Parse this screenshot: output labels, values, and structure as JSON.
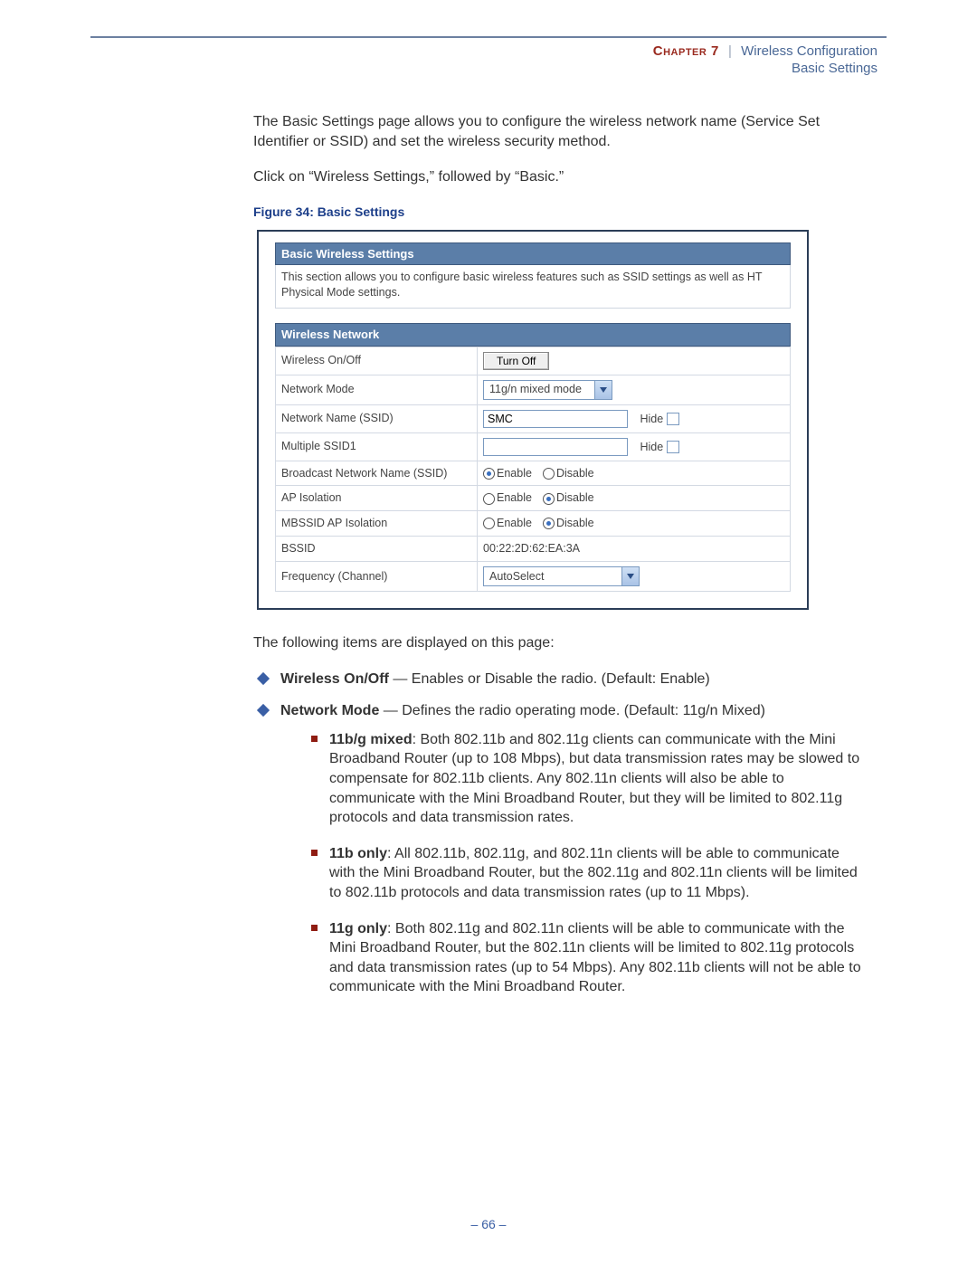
{
  "header": {
    "chapter_label": "Chapter 7",
    "divider": "|",
    "chapter_title": "Wireless Configuration",
    "subtitle": "Basic Settings"
  },
  "intro": {
    "p1": "The Basic Settings page allows you to configure the wireless network name (Service Set Identifier or SSID) and set the wireless security method.",
    "p2": "Click on “Wireless Settings,” followed by “Basic.”"
  },
  "figure": {
    "caption": "Figure 34:  Basic Settings",
    "panel_title": "Basic Wireless Settings",
    "panel_desc": "This section allows you to configure basic wireless features such as SSID settings as well as HT Physical Mode settings.",
    "section_title": "Wireless Network",
    "rows": {
      "wireless_onoff_label": "Wireless On/Off",
      "turn_off_button": "Turn Off",
      "network_mode_label": "Network Mode",
      "network_mode_value": "11g/n mixed mode",
      "ssid_label": "Network Name (SSID)",
      "ssid_value": "SMC",
      "hide_label": "Hide",
      "mssid1_label": "Multiple SSID1",
      "mssid1_value": "",
      "broadcast_label": "Broadcast Network Name (SSID)",
      "ap_iso_label": "AP Isolation",
      "mbssid_iso_label": "MBSSID AP Isolation",
      "bssid_label": "BSSID",
      "bssid_value": "00:22:2D:62:EA:3A",
      "freq_label": "Frequency (Channel)",
      "freq_value": "AutoSelect",
      "enable": "Enable",
      "disable": "Disable"
    }
  },
  "items_intro": "The following items are displayed on this page:",
  "bullets": {
    "b1_bold": "Wireless On/Off",
    "b1_rest": " — Enables or Disable the radio. (Default: Enable)",
    "b2_bold": "Network Mode",
    "b2_rest": " — Defines the radio operating mode. (Default: 11g/n Mixed)",
    "s1_bold": "11b/g mixed",
    "s1_rest": ": Both 802.11b and 802.11g clients can communicate with the Mini Broadband Router (up to 108 Mbps), but data transmission rates may be slowed to compensate for 802.11b clients. Any 802.11n clients will also be able to communicate with the Mini Broadband Router, but they will be limited to 802.11g protocols and data transmission rates.",
    "s2_bold": "11b only",
    "s2_rest": ": All 802.11b, 802.11g, and 802.11n clients will be able to communicate with the Mini Broadband Router, but the 802.11g and 802.11n clients will be limited to 802.11b protocols and data transmission rates (up to 11 Mbps).",
    "s3_bold": "11g only",
    "s3_rest": ": Both 802.11g and 802.11n clients will be able to communicate with the Mini Broadband Router, but the 802.11n clients will be limited to 802.11g protocols and data transmission rates (up to 54 Mbps). Any 802.11b clients will not be able to communicate with the Mini Broadband Router."
  },
  "footer": {
    "page": "–  66  –"
  }
}
